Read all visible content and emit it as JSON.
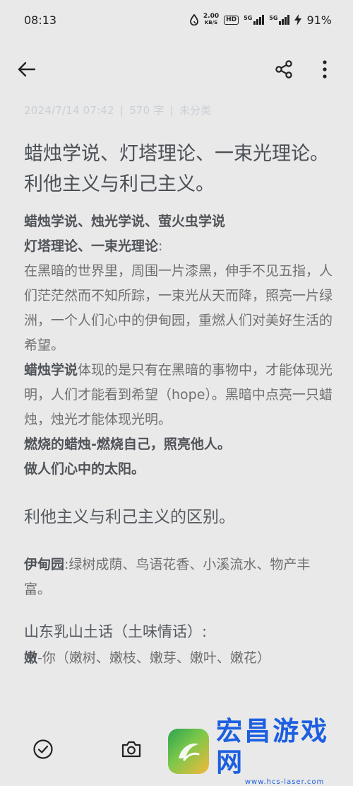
{
  "status": {
    "time": "08:13",
    "speed_value": "2.00",
    "speed_unit": "KB/S",
    "hd_label": "HD",
    "sim1_label": "5G",
    "sim2_label": "5G",
    "battery": "91%"
  },
  "meta": {
    "date": "2024/7/14 07:42",
    "count": "570 字",
    "category": "未分类",
    "separator": "|"
  },
  "note": {
    "title": "蜡烛学说、灯塔理论、一束光理论。利他主义与利己主义。",
    "line1": "蜡烛学说、烛光学说、萤火虫学说",
    "line2_bold": "灯塔理论、一束光理论",
    "line2_rest": ":",
    "para1": "在黑暗的世界里，周围一片漆黑，伸手不见五指，人们茫茫然而不知所踪，一束光从天而降，照亮一片绿洲，一个人们心中的伊甸园，重燃人们对美好生活的希望。",
    "para2_bold": "蜡烛学说",
    "para2_rest": "体现的是只有在黑暗的事物中，才能体现光明，人们才能看到希望（hope）。黑暗中点亮一只蜡烛，烛光才能体现光明。",
    "line3": "燃烧的蜡烛-燃烧自己，照亮他人。",
    "line4": "做人们心中的太阳。",
    "heading2": "利他主义与利己主义的区别。",
    "eden_bold": "伊甸园",
    "eden_rest": ":绿树成荫、鸟语花香、小溪流水、物产丰富。",
    "heading3": "山东乳山土话（土味情话）:",
    "last_bold": "嫩",
    "last_rest": "-你（嫩树、嫩枝、嫩芽、嫩叶、嫩花）"
  },
  "watermark": {
    "name": "宏昌游戏网",
    "url": "www.hcs-laser.com"
  },
  "icons": {
    "back": "back-arrow-icon",
    "share": "share-icon",
    "more": "more-vertical-icon",
    "check": "check-circle-icon",
    "camera": "camera-icon"
  },
  "colors": {
    "background": "#e9e9e9",
    "meta_text": "#c9cfd6",
    "watermark_blue": "#1d5fe0"
  }
}
